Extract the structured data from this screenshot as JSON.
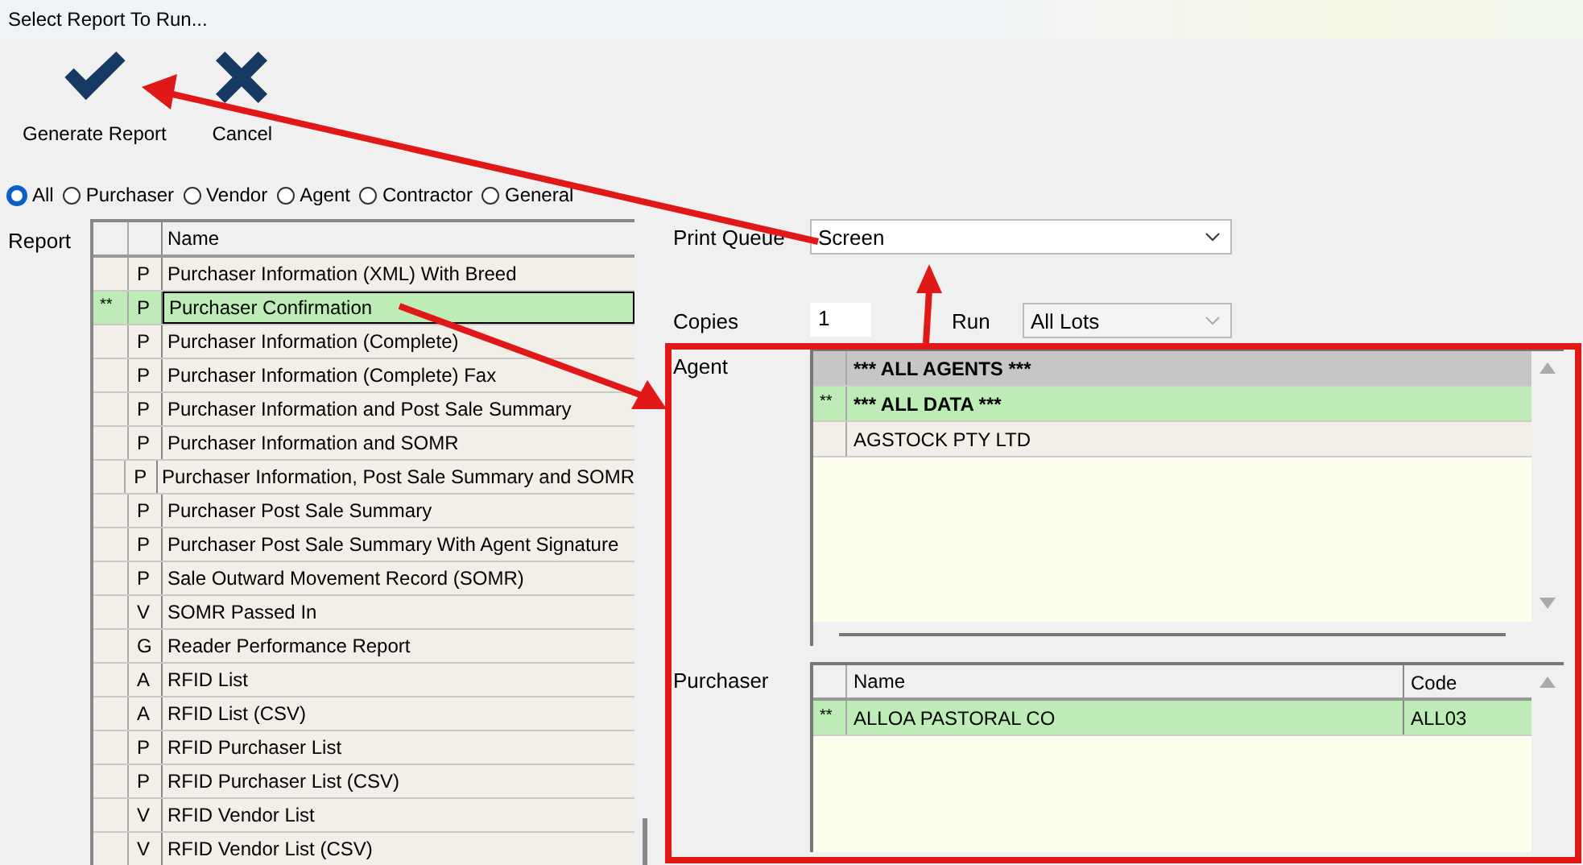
{
  "window": {
    "title": "Select Report To Run..."
  },
  "toolbar": [
    {
      "kind": "confirm",
      "label": "Generate Report"
    },
    {
      "kind": "cancel",
      "label": "Cancel"
    }
  ],
  "filters": [
    {
      "label": "All",
      "selected": true
    },
    {
      "label": "Purchaser",
      "selected": false
    },
    {
      "label": "Vendor",
      "selected": false
    },
    {
      "label": "Agent",
      "selected": false
    },
    {
      "label": "Contractor",
      "selected": false
    },
    {
      "label": "General",
      "selected": false
    }
  ],
  "report": {
    "label": "Report",
    "columns": [
      "Name"
    ],
    "rows": [
      {
        "type": "P",
        "name": "Purchaser Information (XML) With Breed",
        "selected": false
      },
      {
        "marker": "**",
        "type": "P",
        "name": "Purchaser Confirmation",
        "selected": true
      },
      {
        "type": "P",
        "name": "Purchaser Information (Complete)",
        "selected": false
      },
      {
        "type": "P",
        "name": "Purchaser Information (Complete)  Fax",
        "selected": false
      },
      {
        "type": "P",
        "name": "Purchaser Information and Post Sale Summary",
        "selected": false
      },
      {
        "type": "P",
        "name": "Purchaser Information and SOMR",
        "selected": false
      },
      {
        "type": "P",
        "name": "Purchaser Information, Post Sale Summary and SOMR",
        "selected": false
      },
      {
        "type": "P",
        "name": "Purchaser Post Sale Summary",
        "selected": false
      },
      {
        "type": "P",
        "name": "Purchaser Post Sale Summary With Agent Signature",
        "selected": false
      },
      {
        "type": "P",
        "name": "Sale Outward Movement Record (SOMR)",
        "selected": false
      },
      {
        "type": "V",
        "name": "SOMR Passed In",
        "selected": false
      },
      {
        "type": "G",
        "name": "Reader Performance Report",
        "selected": false
      },
      {
        "type": "A",
        "name": "RFID List",
        "selected": false
      },
      {
        "type": "A",
        "name": "RFID List (CSV)",
        "selected": false
      },
      {
        "type": "P",
        "name": "RFID Purchaser List",
        "selected": false
      },
      {
        "type": "P",
        "name": "RFID Purchaser List (CSV)",
        "selected": false
      },
      {
        "type": "V",
        "name": "RFID Vendor List",
        "selected": false
      },
      {
        "type": "V",
        "name": "RFID Vendor List (CSV)",
        "selected": false
      }
    ]
  },
  "print_queue": {
    "label": "Print Queue",
    "value": "Screen"
  },
  "copies": {
    "label": "Copies",
    "value": "1"
  },
  "run": {
    "label": "Run",
    "value": "All Lots"
  },
  "agent": {
    "label": "Agent",
    "rows": [
      {
        "name": "*** ALL AGENTS ***",
        "kind": "special",
        "focused": true,
        "selected": false
      },
      {
        "marker": "**",
        "name": "*** ALL DATA ***",
        "kind": "special",
        "focused": false,
        "selected": true
      },
      {
        "name": "AGSTOCK PTY LTD",
        "kind": "item",
        "focused": false,
        "selected": false
      }
    ]
  },
  "purchaser": {
    "label": "Purchaser",
    "columns": [
      "Name",
      "Code"
    ],
    "rows": [
      {
        "marker": "**",
        "name": "ALLOA PASTORAL CO",
        "code": "ALL03",
        "selected": true
      }
    ]
  }
}
